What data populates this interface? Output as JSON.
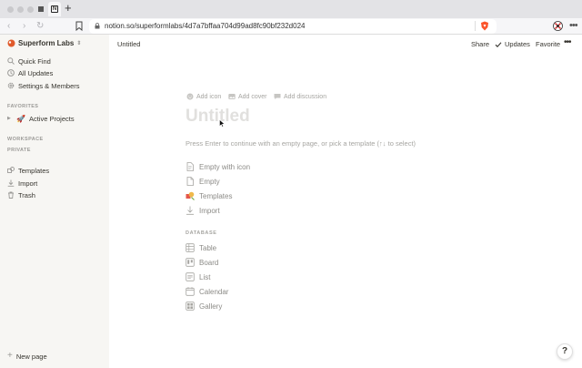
{
  "browser": {
    "url": "notion.so/superformlabs/4d7a7bffaa704d99ad8fc90bf232d024",
    "tab_glyph": "N",
    "new_tab": "+",
    "nav_back": "‹",
    "nav_forward": "›",
    "reload": "↻",
    "menu": "•••",
    "colors": {
      "brave": "#fb542b",
      "tabbar": "#e3e3e6"
    }
  },
  "sidebar": {
    "workspace_name": "Superform Labs",
    "workspace_caret": "⇕",
    "items": [
      {
        "label": "Quick Find",
        "icon": "search-icon"
      },
      {
        "label": "All Updates",
        "icon": "clock-icon"
      },
      {
        "label": "Settings & Members",
        "icon": "gear-icon"
      }
    ],
    "favorites_label": "FAVORITES",
    "favorites": [
      {
        "label": "Active Projects",
        "emoji": "🚀"
      }
    ],
    "workspace_label": "WORKSPACE",
    "private_label": "PRIVATE",
    "bottom_items": [
      {
        "label": "Templates",
        "icon": "templates-icon"
      },
      {
        "label": "Import",
        "icon": "import-icon"
      },
      {
        "label": "Trash",
        "icon": "trash-icon"
      }
    ],
    "new_page": "New page"
  },
  "topbar": {
    "title": "Untitled",
    "share": "Share",
    "updates": "Updates",
    "favorite": "Favorite",
    "more": "•••"
  },
  "page": {
    "add_icon": "Add icon",
    "add_cover": "Add cover",
    "add_discussion": "Add discussion",
    "title_placeholder": "Untitled",
    "hint": "Press Enter to continue with an empty page, or pick a template (↑↓ to select)",
    "options": [
      {
        "label": "Empty with icon",
        "icon": "page-icon"
      },
      {
        "label": "Empty",
        "icon": "page-icon"
      },
      {
        "label": "Templates",
        "icon": "templates-icon"
      },
      {
        "label": "Import",
        "icon": "import-icon"
      }
    ],
    "database_label": "DATABASE",
    "database_options": [
      {
        "label": "Table",
        "icon": "table-icon"
      },
      {
        "label": "Board",
        "icon": "board-icon"
      },
      {
        "label": "List",
        "icon": "list-icon"
      },
      {
        "label": "Calendar",
        "icon": "calendar-icon"
      },
      {
        "label": "Gallery",
        "icon": "gallery-icon"
      }
    ],
    "help": "?"
  }
}
